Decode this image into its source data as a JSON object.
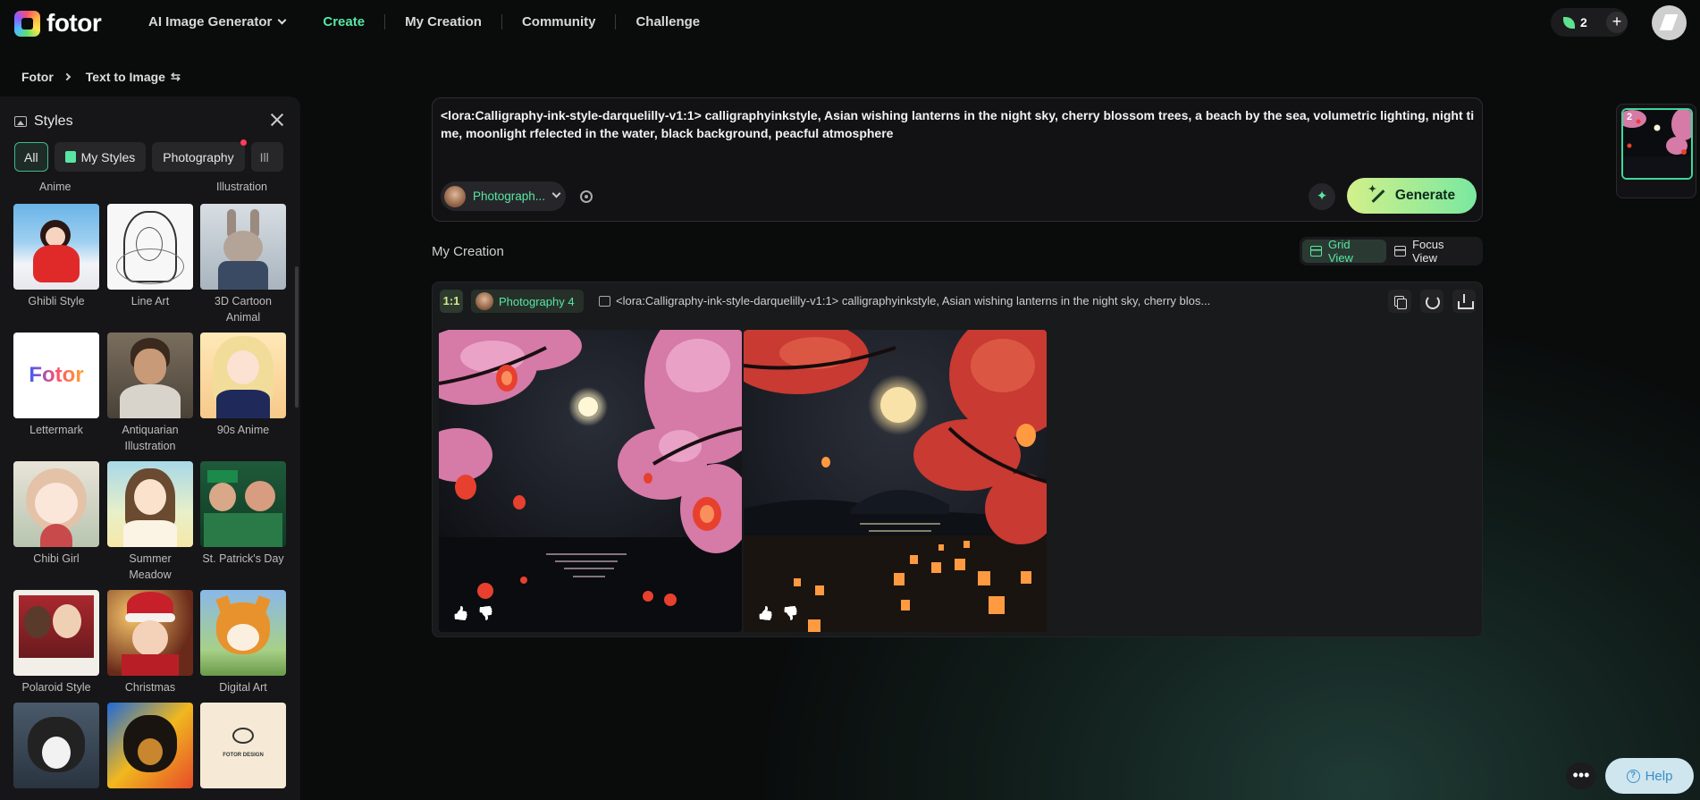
{
  "header": {
    "logo_text": "fotor",
    "product_menu": "AI Image Generator",
    "nav": [
      "Create",
      "My Creation",
      "Community",
      "Challenge"
    ],
    "credits": "2",
    "plus_label": "+"
  },
  "breadcrumb": {
    "root": "Fotor",
    "current": "Text to Image",
    "swap_glyph": "⇆"
  },
  "styles_panel": {
    "title": "Styles",
    "chips": [
      "All",
      "My Styles",
      "Photography",
      "Ill"
    ],
    "top_labels": [
      "Anime",
      "Illustration"
    ],
    "items": [
      {
        "label": "Ghibli Style"
      },
      {
        "label": "Line Art"
      },
      {
        "label": "3D Cartoon Animal"
      },
      {
        "label": "Lettermark",
        "logo": "Fotor"
      },
      {
        "label": "Antiquarian Illustration"
      },
      {
        "label": "90s Anime"
      },
      {
        "label": "Chibi Girl"
      },
      {
        "label": "Summer Meadow"
      },
      {
        "label": "St. Patrick's Day"
      },
      {
        "label": "Polaroid Style"
      },
      {
        "label": "Christmas"
      },
      {
        "label": "Digital Art"
      },
      {
        "label": ""
      },
      {
        "label": ""
      },
      {
        "label": "",
        "logo": "FOTOR DESIGN"
      }
    ]
  },
  "prompt": {
    "text": "<lora:Calligraphy-ink-style-darquelilly-v1:1> calligraphyinkstyle, Asian wishing lanterns in the night sky, cherry blossom trees, a beach by the sea, volumetric lighting, night time, moonlight rfelected in the water, black background, peacful atmosphere",
    "style_label": "Photograph...",
    "sparkle_glyph": "✦",
    "generate_label": "Generate"
  },
  "creation": {
    "title": "My Creation",
    "grid_view": "Grid View",
    "focus_view": "Focus View",
    "ratio": "1:1",
    "style": "Photography 4",
    "prompt_preview": "<lora:Calligraphy-ink-style-darquelilly-v1:1> calligraphyinkstyle, Asian wishing lanterns in the night sky, cherry blos..."
  },
  "history": {
    "count": "2"
  },
  "footer": {
    "more": "•••",
    "help": "Help",
    "help_glyph": "?"
  },
  "colors": {
    "accent": "#58e6a2",
    "generate_start": "#d2f08a",
    "generate_end": "#7ae8a0",
    "help_bg": "#cfe6ef"
  }
}
